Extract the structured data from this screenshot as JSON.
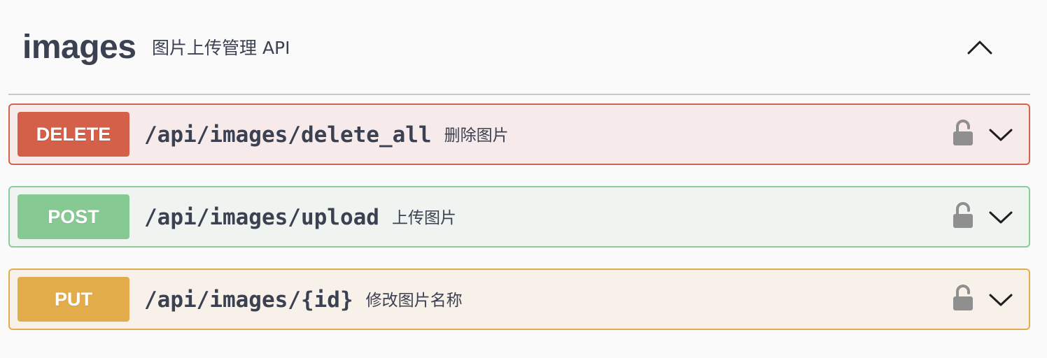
{
  "tag": {
    "name": "images",
    "description": "图片上传管理 API",
    "toggle_icon": "chevron-up-icon"
  },
  "operations": [
    {
      "method": "DELETE",
      "path": "/api/images/delete_all",
      "summary": "删除图片",
      "color": "#d4604a",
      "background": "#f6ebea",
      "border": "#d5634c",
      "lock_icon": "unlocked-padlock-icon",
      "expand_icon": "chevron-down-icon"
    },
    {
      "method": "POST",
      "path": "/api/images/upload",
      "summary": "上传图片",
      "color": "#87c993",
      "background": "#eff4f0",
      "border": "#8acd9a",
      "lock_icon": "unlocked-padlock-icon",
      "expand_icon": "chevron-down-icon"
    },
    {
      "method": "PUT",
      "path": "/api/images/{id}",
      "summary": "修改图片名称",
      "color": "#e2ac4b",
      "background": "#f8f1e9",
      "border": "#e1ad4d",
      "lock_icon": "unlocked-padlock-icon",
      "expand_icon": "chevron-down-icon"
    }
  ]
}
